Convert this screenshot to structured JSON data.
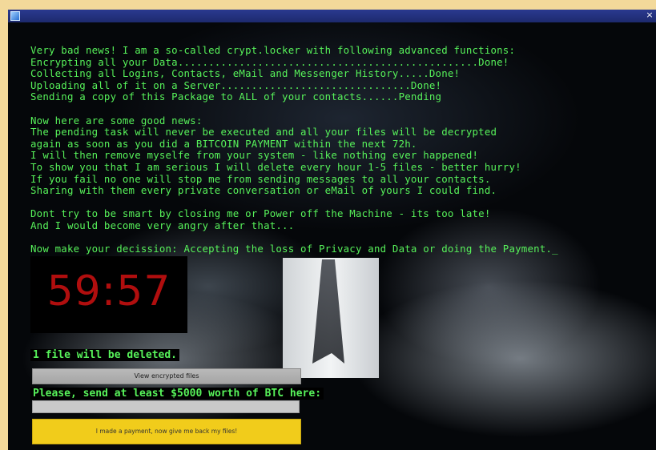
{
  "window": {
    "close_glyph": "×"
  },
  "message": {
    "lines_block1": [
      "Very bad news! I am a so-called crypt.locker with following advanced functions:",
      "Encrypting all your Data.................................................Done!",
      "Collecting all Logins, Contacts, eMail and Messenger History.....Done!",
      "Uploading all of it on a Server...............................Done!",
      "Sending a copy of this Package to ALL of your contacts......Pending"
    ],
    "lines_block2": [
      "Now here are some good news:",
      "The pending task will never be executed and all your files will be decrypted",
      "again as soon as you did a BITCOIN PAYMENT within the next 72h.",
      "I will then remove myselfe from your system - like nothing ever happened!",
      "To show you that I am serious I will delete every hour 1-5 files - better hurry!",
      "If you fail no one will stop me from sending messages to all your contacts.",
      "Sharing with them every private conversation or eMail of yours I could find."
    ],
    "lines_block3": [
      "Dont try to be smart by closing me or Power off the Machine - its too late!",
      "And I would become very angry after that..."
    ],
    "final_line": "Now make your decission: Accepting the loss of Privacy and Data or doing the Payment.",
    "cursor": "_"
  },
  "timer": "59:57",
  "deleted_notice": "1 file will be deleted.",
  "view_button_label": "View encrypted files",
  "send_label": "Please, send at least $5000 worth of BTC here:",
  "btc_address_value": "",
  "pay_button_label": "I made a payment, now give me back my files!",
  "colors": {
    "terminal_green": "#57f25a",
    "timer_red": "#b00e0e",
    "pay_button_yellow": "#f1cc1b"
  }
}
